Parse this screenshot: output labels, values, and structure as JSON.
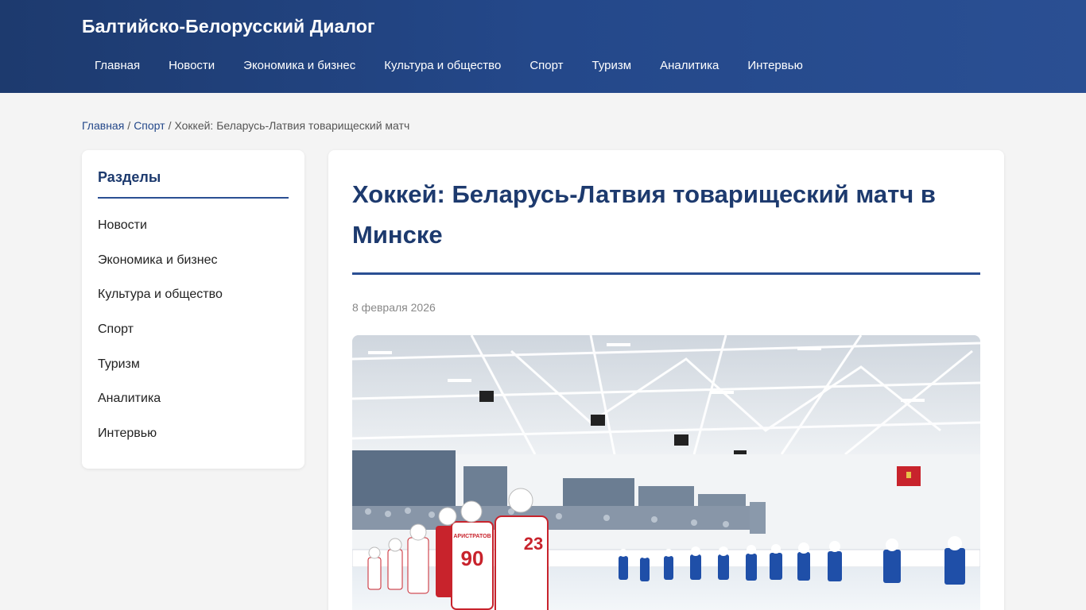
{
  "site": {
    "title": "Балтийско-Белорусский Диалог"
  },
  "nav": {
    "items": [
      {
        "label": "Главная"
      },
      {
        "label": "Новости"
      },
      {
        "label": "Экономика и бизнес"
      },
      {
        "label": "Культура и общество"
      },
      {
        "label": "Спорт"
      },
      {
        "label": "Туризм"
      },
      {
        "label": "Аналитика"
      },
      {
        "label": "Интервью"
      }
    ]
  },
  "breadcrumb": {
    "home": "Главная",
    "section": "Спорт",
    "current": "Хоккей: Беларусь-Латвия товарищеский матч",
    "separator": "/"
  },
  "sidebar": {
    "title": "Разделы",
    "items": [
      {
        "label": "Новости"
      },
      {
        "label": "Экономика и бизнес"
      },
      {
        "label": "Культура и общество"
      },
      {
        "label": "Спорт"
      },
      {
        "label": "Туризм"
      },
      {
        "label": "Аналитика"
      },
      {
        "label": "Интервью"
      }
    ]
  },
  "article": {
    "title": "Хоккей: Беларусь-Латвия товарищеский матч в Минске",
    "date": "8 февраля 2026",
    "image": {
      "jersey_red_number_1": "90",
      "jersey_red_number_2": "23",
      "jersey_red_name": "АРИСТРАТОВ"
    }
  },
  "colors": {
    "header_bg": "#24488a",
    "accent": "#1d3a6e",
    "link": "#24488a",
    "team_red": "#c8232c",
    "team_blue": "#1f4fa8"
  }
}
